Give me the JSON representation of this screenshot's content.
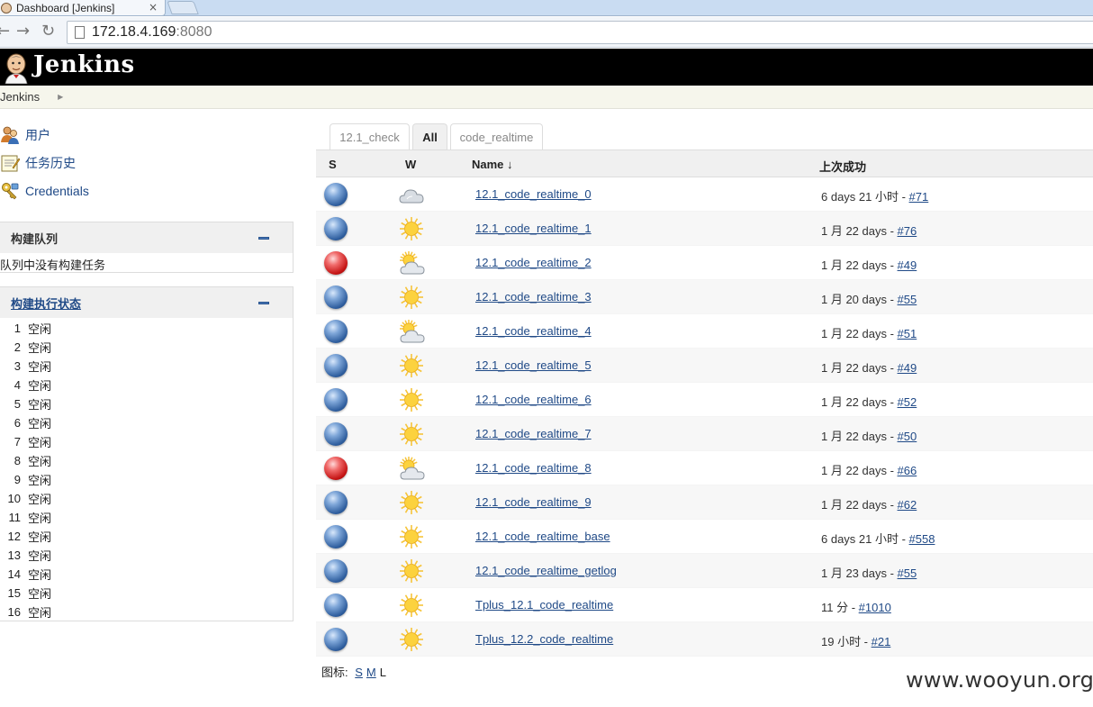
{
  "browser": {
    "tab_title": "Dashboard [Jenkins]",
    "close_glyph": "×",
    "url_host": "172.18.4.169",
    "url_port": ":8080"
  },
  "header": {
    "brand": "Jenkins"
  },
  "breadcrumb": {
    "root": "Jenkins",
    "arrow": "▶"
  },
  "sidebar": {
    "tasks": [
      {
        "label": "用户",
        "icon": "users-icon"
      },
      {
        "label": "任务历史",
        "icon": "notepad-icon"
      },
      {
        "label": "Credentials",
        "icon": "credentials-key-icon"
      }
    ],
    "build_queue": {
      "title": "构建队列",
      "empty_text": "队列中没有构建任务"
    },
    "executor_status": {
      "title": "构建执行状态",
      "executors": [
        {
          "num": "1",
          "status": "空闲"
        },
        {
          "num": "2",
          "status": "空闲"
        },
        {
          "num": "3",
          "status": "空闲"
        },
        {
          "num": "4",
          "status": "空闲"
        },
        {
          "num": "5",
          "status": "空闲"
        },
        {
          "num": "6",
          "status": "空闲"
        },
        {
          "num": "7",
          "status": "空闲"
        },
        {
          "num": "8",
          "status": "空闲"
        },
        {
          "num": "9",
          "status": "空闲"
        },
        {
          "num": "10",
          "status": "空闲"
        },
        {
          "num": "11",
          "status": "空闲"
        },
        {
          "num": "12",
          "status": "空闲"
        },
        {
          "num": "13",
          "status": "空闲"
        },
        {
          "num": "14",
          "status": "空闲"
        },
        {
          "num": "15",
          "status": "空闲"
        },
        {
          "num": "16",
          "status": "空闲"
        }
      ]
    }
  },
  "views": {
    "tabs": [
      {
        "label": "12.1_check",
        "active": false
      },
      {
        "label": "All",
        "active": true
      },
      {
        "label": "code_realtime",
        "active": false
      }
    ]
  },
  "table": {
    "headers": {
      "status": "S",
      "weather": "W",
      "name": "Name ↓",
      "last_success": "上次成功"
    },
    "jobs": [
      {
        "status": "blue",
        "weather": "cloudy",
        "name": "12.1_code_realtime_0",
        "last_success": "6 days 21 小时 - ",
        "build": "#71"
      },
      {
        "status": "blue",
        "weather": "sunny",
        "name": "12.1_code_realtime_1",
        "last_success": "1 月 22 days - ",
        "build": "#76"
      },
      {
        "status": "red",
        "weather": "partly-cloudy",
        "name": "12.1_code_realtime_2",
        "last_success": "1 月 22 days - ",
        "build": "#49"
      },
      {
        "status": "blue",
        "weather": "sunny",
        "name": "12.1_code_realtime_3",
        "last_success": "1 月 20 days - ",
        "build": "#55"
      },
      {
        "status": "blue",
        "weather": "partly-cloudy",
        "name": "12.1_code_realtime_4",
        "last_success": "1 月 22 days - ",
        "build": "#51"
      },
      {
        "status": "blue",
        "weather": "sunny",
        "name": "12.1_code_realtime_5",
        "last_success": "1 月 22 days - ",
        "build": "#49"
      },
      {
        "status": "blue",
        "weather": "sunny",
        "name": "12.1_code_realtime_6",
        "last_success": "1 月 22 days - ",
        "build": "#52"
      },
      {
        "status": "blue",
        "weather": "sunny",
        "name": "12.1_code_realtime_7",
        "last_success": "1 月 22 days - ",
        "build": "#50"
      },
      {
        "status": "red",
        "weather": "partly-cloudy",
        "name": "12.1_code_realtime_8",
        "last_success": "1 月 22 days - ",
        "build": "#66"
      },
      {
        "status": "blue",
        "weather": "sunny",
        "name": "12.1_code_realtime_9",
        "last_success": "1 月 22 days - ",
        "build": "#62"
      },
      {
        "status": "blue",
        "weather": "sunny",
        "name": "12.1_code_realtime_base",
        "last_success": "6 days 21 小时 - ",
        "build": "#558"
      },
      {
        "status": "blue",
        "weather": "sunny",
        "name": "12.1_code_realtime_getlog",
        "last_success": "1 月 23 days - ",
        "build": "#55"
      },
      {
        "status": "blue",
        "weather": "sunny",
        "name": "Tplus_12.1_code_realtime",
        "last_success": "11 分 - ",
        "build": "#1010"
      },
      {
        "status": "blue",
        "weather": "sunny",
        "name": "Tplus_12.2_code_realtime",
        "last_success": "19 小时 - ",
        "build": "#21"
      }
    ]
  },
  "icon_size": {
    "label": "图标:",
    "small": "S",
    "medium": "M",
    "large": "L"
  },
  "watermark": "www.wooyun.org",
  "colors": {
    "link": "#204a87",
    "header_bg": "#000000",
    "ball_blue": "#2f5e9e",
    "ball_red": "#c41414"
  }
}
